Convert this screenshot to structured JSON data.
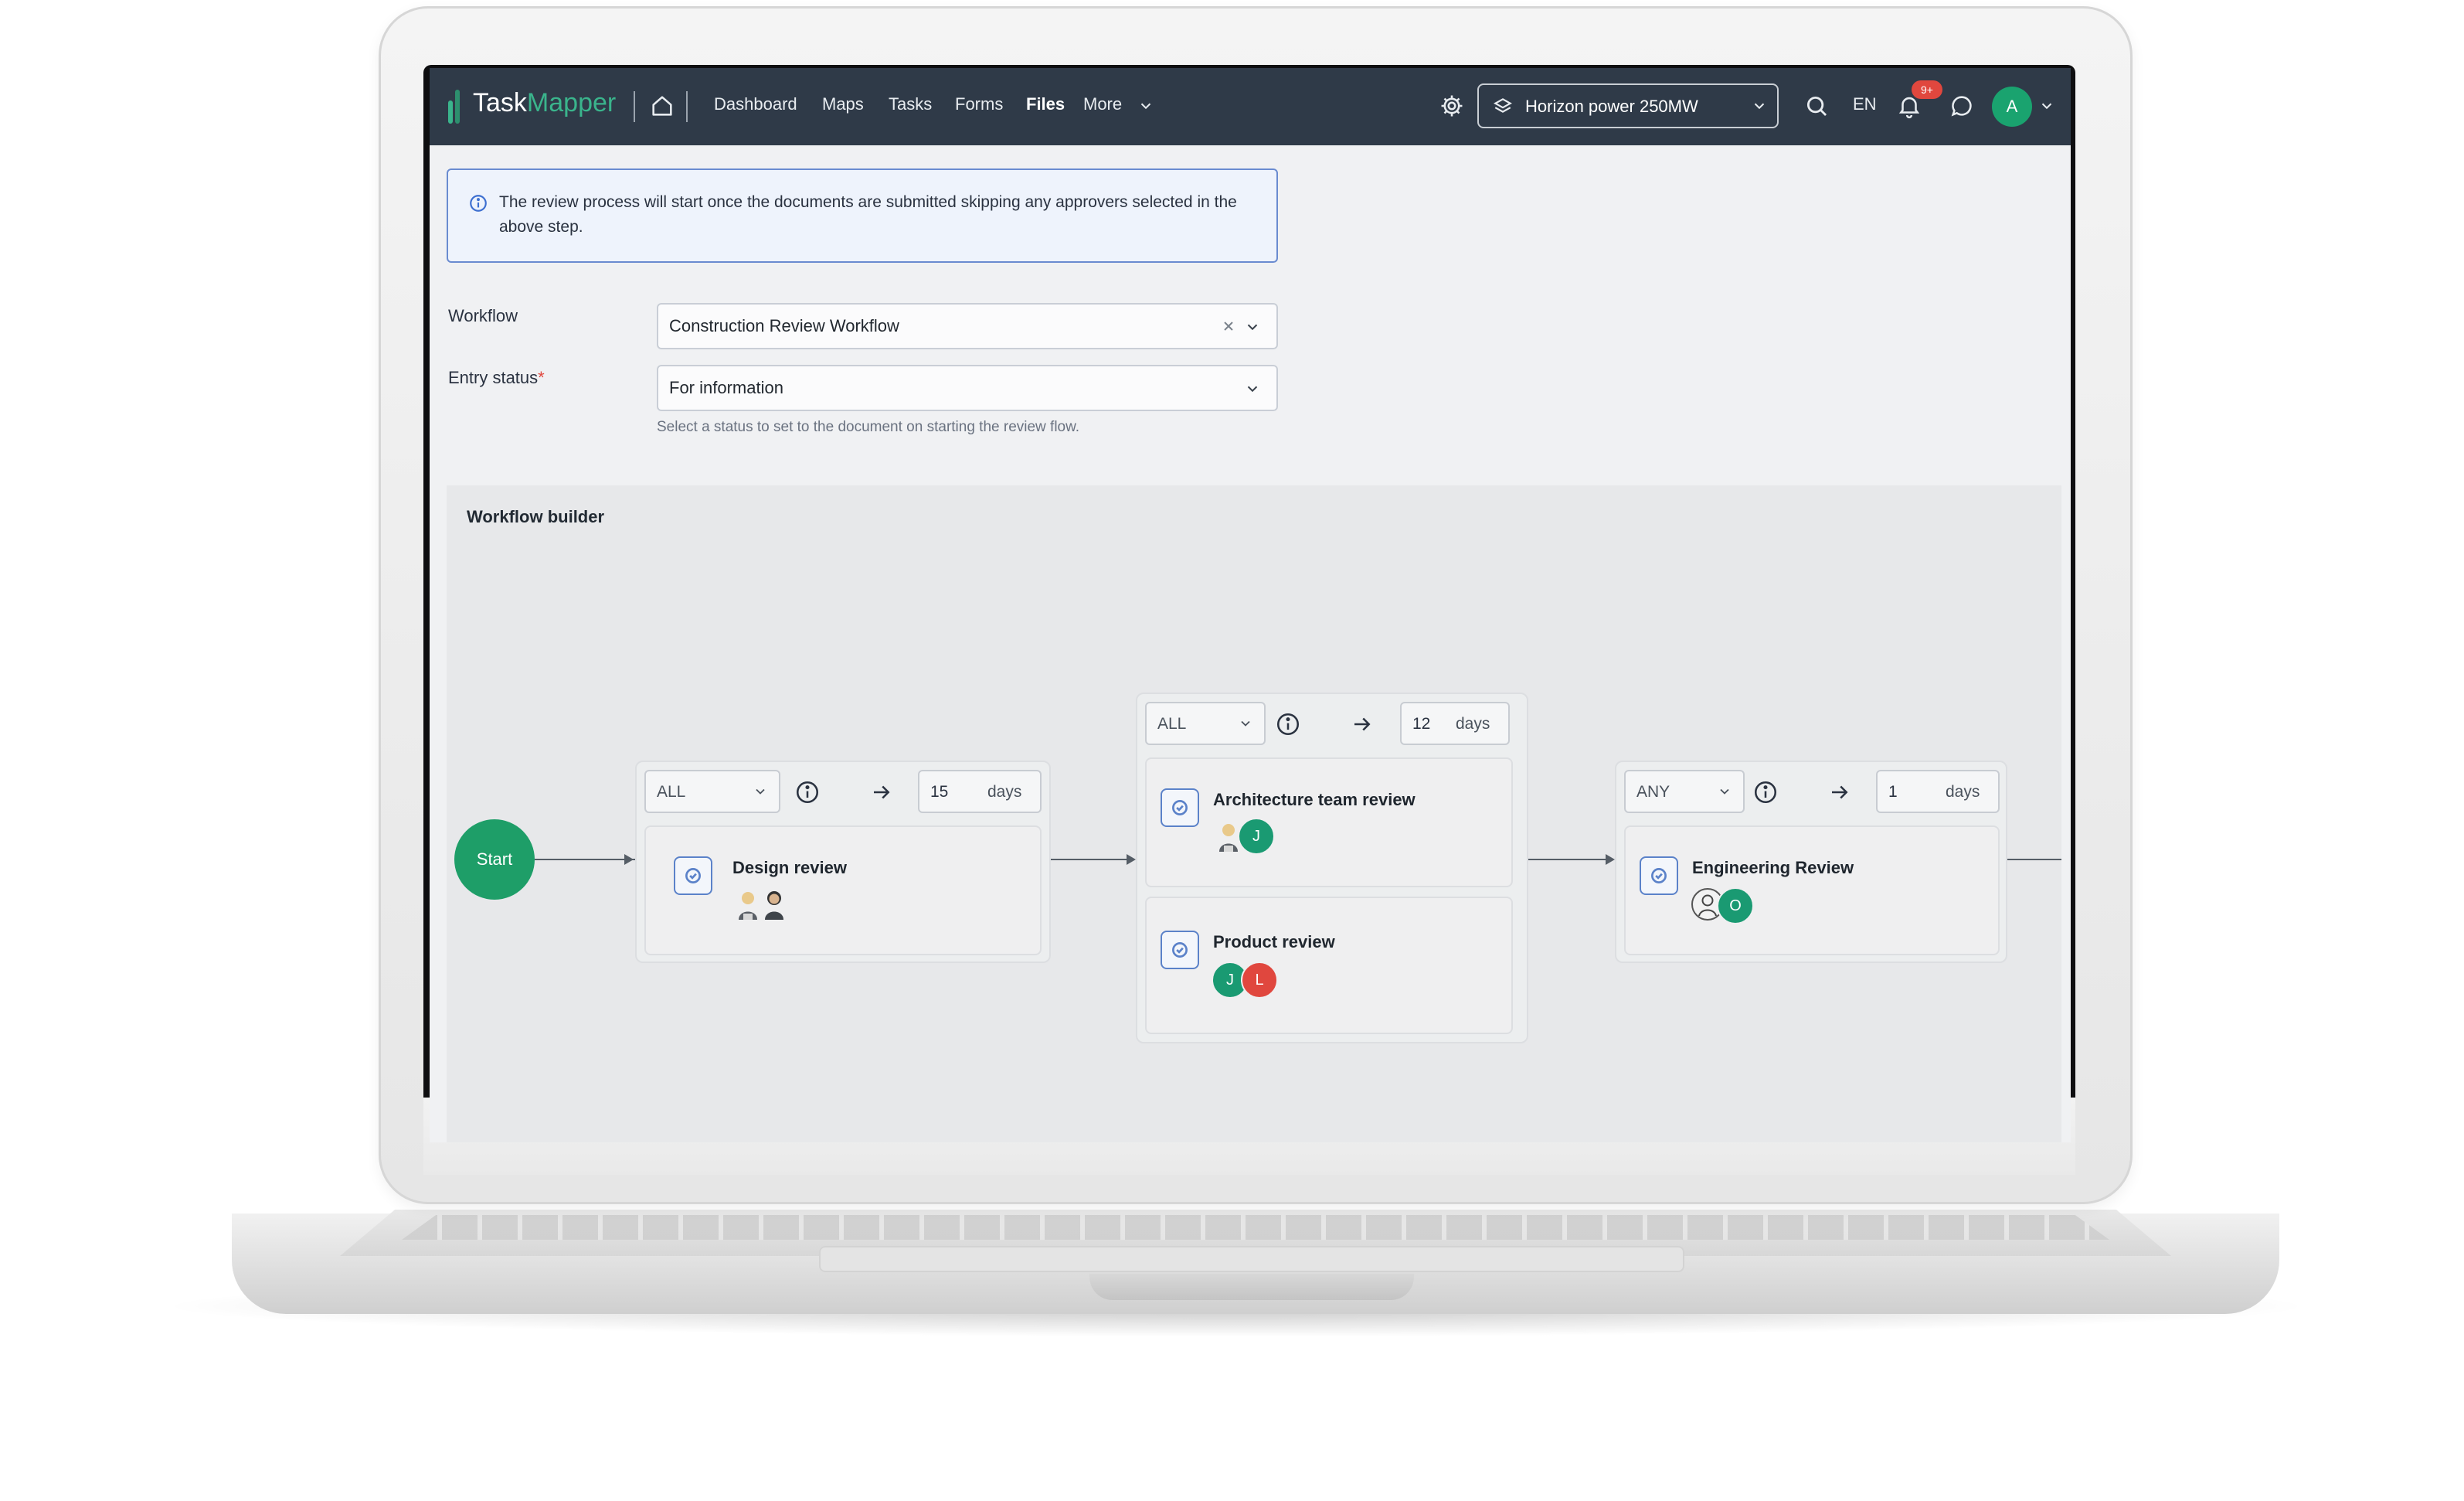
{
  "app": {
    "logo_task": "Task",
    "logo_mapper": "Mapper",
    "brand_color": "#3ab48c"
  },
  "nav": {
    "links": [
      "Dashboard",
      "Maps",
      "Tasks",
      "Forms",
      "Files",
      "More"
    ],
    "active": "Files",
    "project": "Horizon power 250MW",
    "language": "EN",
    "notification_badge": "9+",
    "user_initial": "A"
  },
  "info": {
    "text": "The review process will start once the documents are submitted skipping any approvers selected in the above step."
  },
  "form": {
    "workflow_label": "Workflow",
    "workflow_value": "Construction Review Workflow",
    "entry_status_label": "Entry status",
    "required_mark": "*",
    "entry_status_value": "For information",
    "entry_status_hint": "Select a status to set to the document on starting the review flow."
  },
  "builder": {
    "title": "Workflow builder",
    "start_label": "Start",
    "days_label": "days",
    "steps": [
      {
        "condition": "ALL",
        "days": "15",
        "reviews": [
          {
            "title": "Design review",
            "avatars": [
              "photo",
              "photo"
            ]
          }
        ]
      },
      {
        "condition": "ALL",
        "days": "12",
        "reviews": [
          {
            "title": "Architecture team review",
            "avatars": [
              "photo",
              "J"
            ]
          },
          {
            "title": "Product review",
            "avatars": [
              "J",
              "L"
            ]
          }
        ]
      },
      {
        "condition": "ANY",
        "days": "1",
        "reviews": [
          {
            "title": "Engineering Review",
            "avatars": [
              "photo",
              "O"
            ]
          }
        ]
      }
    ]
  },
  "colors": {
    "nav_bg": "#2f3a48",
    "start": "#1e9e68",
    "avatar_green": "#1a9a72",
    "avatar_red": "#e0473e",
    "badge_red": "#e0473e"
  }
}
